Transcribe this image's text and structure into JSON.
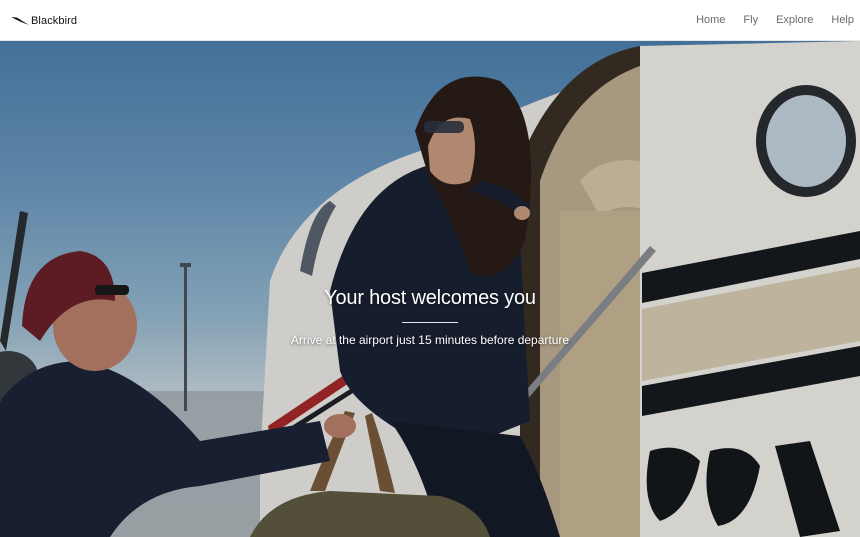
{
  "brand": {
    "name": "Blackbird",
    "logo_icon": "blackbird-wing-icon",
    "accent_color": "#111111"
  },
  "nav": {
    "items": [
      {
        "label": "Home"
      },
      {
        "label": "Fly"
      },
      {
        "label": "Explore"
      },
      {
        "label": "Help"
      }
    ]
  },
  "hero": {
    "title": "Your host welcomes you",
    "subtitle": "Arrive at the airport just 15 minutes before departure",
    "image": "photo-host-greeting-passenger-at-private-plane"
  }
}
